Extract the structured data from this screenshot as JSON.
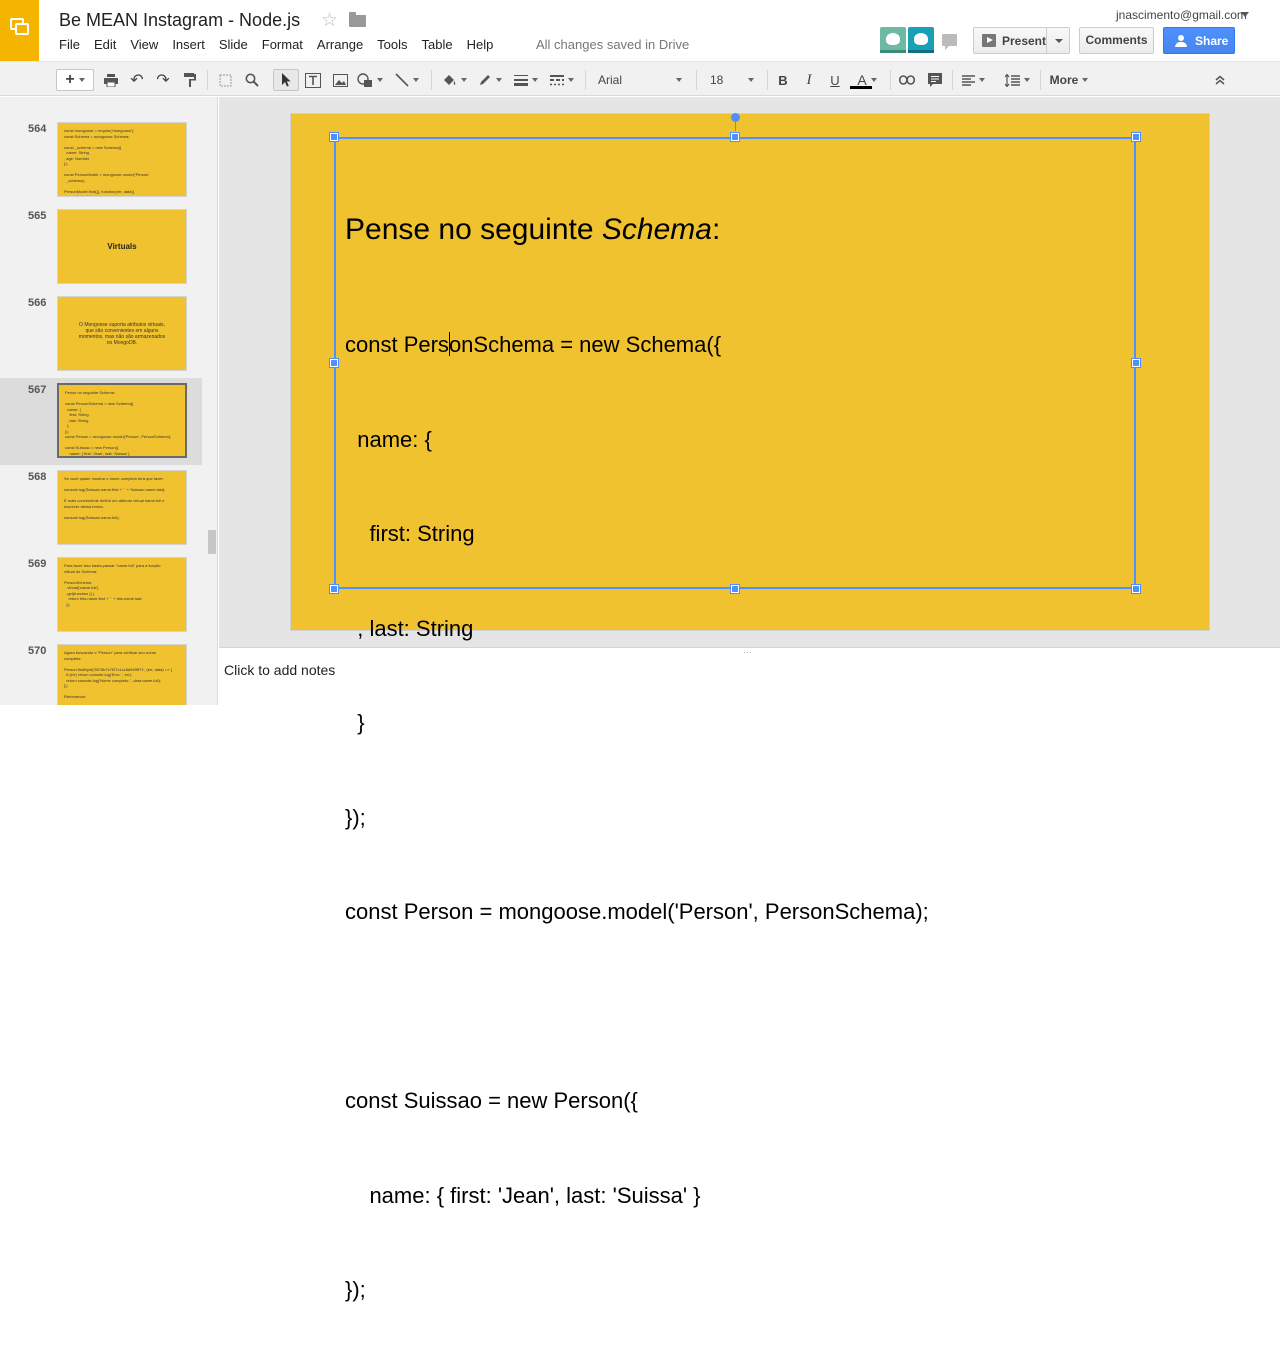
{
  "doc": {
    "title": "Be MEAN Instagram - Node.js",
    "save_status": "All changes saved in Drive",
    "user_email": "jnascimento@gmail.com"
  },
  "menu": [
    "File",
    "Edit",
    "View",
    "Insert",
    "Slide",
    "Format",
    "Arrange",
    "Tools",
    "Table",
    "Help"
  ],
  "buttons": {
    "present": "Present",
    "comments": "Comments",
    "share": "Share"
  },
  "toolbar": {
    "new": "+",
    "font": "Arial",
    "size": "18",
    "bold": "B",
    "italic": "I",
    "underline": "U",
    "text_color": "A",
    "more": "More"
  },
  "slides": [
    {
      "num": "564",
      "kind": "text",
      "text": "const mongoose = require('mongoose');\nconst Schema = mongoose.Schema;\n\nconst _schema = new Schema({\n  name: String\n, age: Number\n});\n\nconst PersonModel = mongoose.model('Person',\n  _schema);\n\nPersonModel.find({}, function(err, data){\n  console.log(data);\n});"
    },
    {
      "num": "565",
      "kind": "title",
      "text": "Virtuals"
    },
    {
      "num": "566",
      "kind": "center",
      "text": "O Mongoose suporta atributos virtuais, que são convenientes em alguns momentos, mas não são armazenados no MongoDB."
    },
    {
      "num": "567",
      "kind": "text",
      "selected": true,
      "text": "Pense no seguinte Schema:\n\nconst PersonSchema = new Schema({\n  name: {\n    first: String\n  , last: String\n  }\n});\nconst Person = mongoose.model('Person', PersonSchema);\n\nconst Suissao = new Person({\n    name: { first: 'Jean', last: 'Suissa' }\n});"
    },
    {
      "num": "568",
      "kind": "text",
      "text": "Se você quiser mostrar o nome completo terá que fazer:\n\nconsole.log(Suissao.name.first + ' ' + Suissao.name.last);\n\nÉ mais conveniente definir um atributo virtual name.full e\nescrever dessa forma:\n\nconsole.log(Suissao.name.full);"
    },
    {
      "num": "569",
      "kind": "text",
      "text": "Para fazer isso basta passar \"name.full\" para a função\nvirtual do Schema:\n\nPersonSchema\n  .virtual('name.full')\n  .get(function () {\n    return this.name.first + ' ' + this.name.last;\n  });"
    },
    {
      "num": "570",
      "kind": "text",
      "text": "Agora buscando o \"Person\" para verificar seu nome\ncompleto:\n\nPerson.findById('5575b7c7f27c1cc5d049ff71', (err, data) => {\n  if (err) return console.log('Erro: ', err);\n  return console.log('Nome completo: ', data.name.full);\n});\n\nRetornando:"
    }
  ],
  "current_slide": {
    "title_plain": "Pense no seguinte ",
    "title_em": "Schema",
    "title_end": ":",
    "line1_a": "const Pers",
    "line1_b": "onSchema = new Schema({",
    "lines": [
      "  name: {",
      "    first: String",
      "  , last: String",
      "  }",
      "});",
      "const Person = mongoose.model('Person', PersonSchema);",
      "",
      "const Suissao = new Person({",
      "    name: { first: 'Jean', last: 'Suissa' }",
      "});"
    ]
  },
  "notes": {
    "placeholder": "Click to add notes"
  },
  "colors": {
    "slide_bg": "#f0c230",
    "selection": "#4d90fe",
    "share": "#4d90fe",
    "logo": "#f4b400"
  }
}
